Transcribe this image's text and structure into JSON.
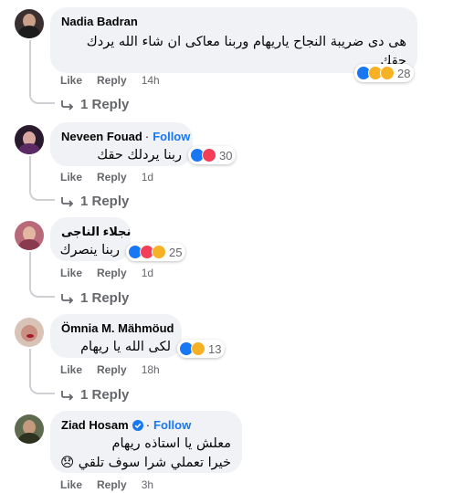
{
  "comments": [
    {
      "author": "Nadia Badran",
      "text_lines": [
        "هى دى ضريبة النجاح ياريهام وربنا معاكى ان شاء الله يردك",
        "حقك"
      ],
      "reaction_count": "28",
      "reactions": [
        "like",
        "haha",
        "care"
      ],
      "like_label": "Like",
      "reply_label": "Reply",
      "time": "14h",
      "replies_label": "1 Reply"
    },
    {
      "author": "Neveen Fouad",
      "follow": "Follow",
      "separator": "·",
      "text_lines": [
        "ربنا يردلك حقك"
      ],
      "reaction_count": "30",
      "reactions": [
        "like",
        "love"
      ],
      "like_label": "Like",
      "reply_label": "Reply",
      "time": "1d",
      "replies_label": "1 Reply"
    },
    {
      "author": "نجلاء الناجى",
      "text_lines": [
        "ربنا ينصرك"
      ],
      "reaction_count": "25",
      "reactions": [
        "like",
        "love",
        "care"
      ],
      "like_label": "Like",
      "reply_label": "Reply",
      "time": "1d",
      "replies_label": "1 Reply"
    },
    {
      "author": "Ömnia M. Mähmöud",
      "text_lines": [
        "لكى الله يا ريهام"
      ],
      "reaction_count": "13",
      "reactions": [
        "like",
        "care"
      ],
      "like_label": "Like",
      "reply_label": "Reply",
      "time": "18h",
      "replies_label": "1 Reply"
    },
    {
      "author": "Ziad Hosam",
      "follow": "Follow",
      "separator": "·",
      "text_lines": [
        "معلش يا استاذه ريهام",
        "خيرا تعملي شرا سوف تلقي 😞"
      ],
      "like_label": "Like",
      "reply_label": "Reply",
      "time": "3h"
    }
  ],
  "colors": {
    "accent": "#1877f2",
    "bubble": "#f0f2f5",
    "muted": "#65676b",
    "thread_line": "#ced0d4"
  }
}
